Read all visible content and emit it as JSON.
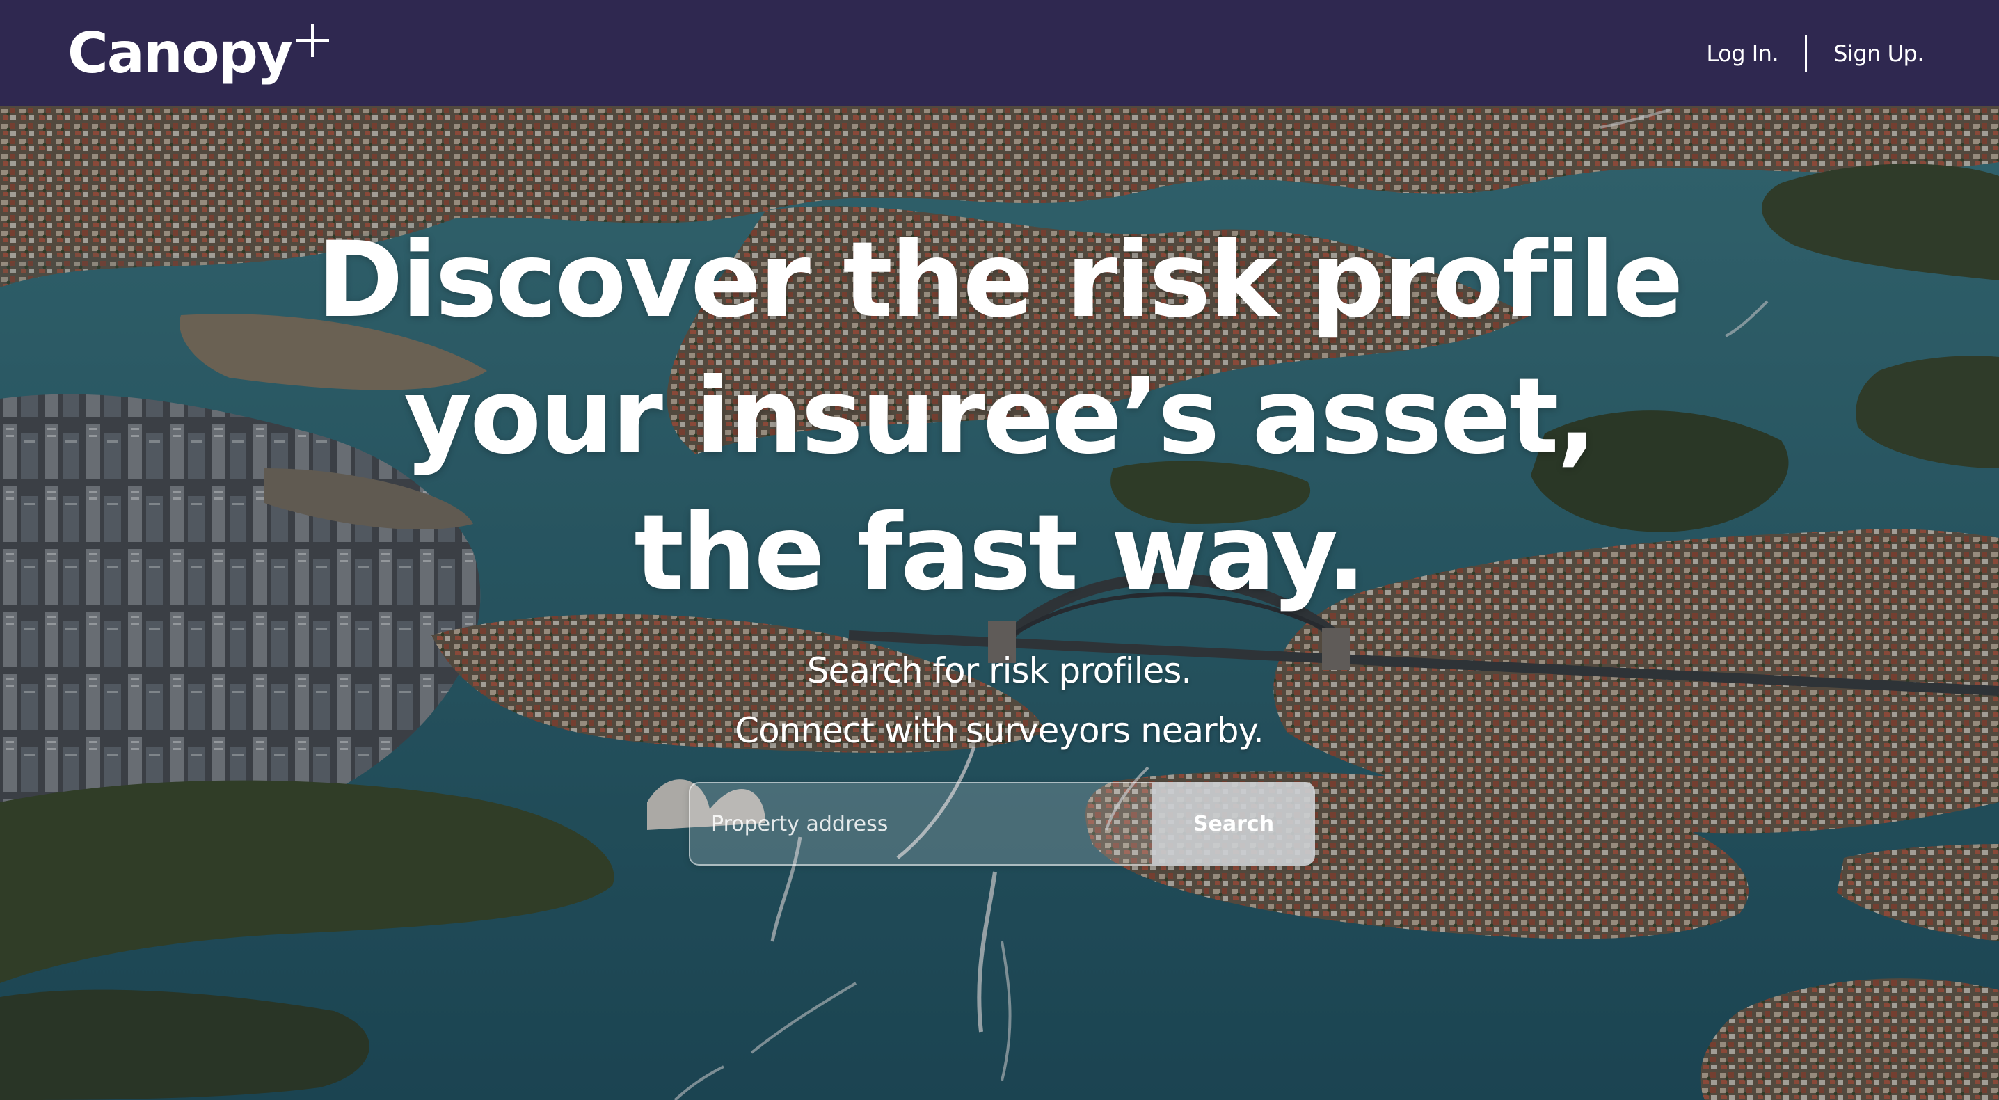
{
  "brand": {
    "name": "Canopy",
    "mark": "plus-icon"
  },
  "nav": {
    "login_label": "Log In.",
    "signup_label": "Sign Up."
  },
  "hero": {
    "headline_lines": [
      "Discover the risk profile",
      "your insuree’s asset,",
      "the fast way."
    ],
    "subline_lines": [
      "Search for risk profiles.",
      "Connect with surveyors nearby."
    ],
    "background": "aerial-harbour-city-photo"
  },
  "search": {
    "placeholder": "Property address",
    "value": "",
    "button_label": "Search"
  },
  "colors": {
    "navbar": "#2f2850",
    "text": "#ffffff",
    "water": "#2b6a7a",
    "button": "#cdd0d4"
  }
}
